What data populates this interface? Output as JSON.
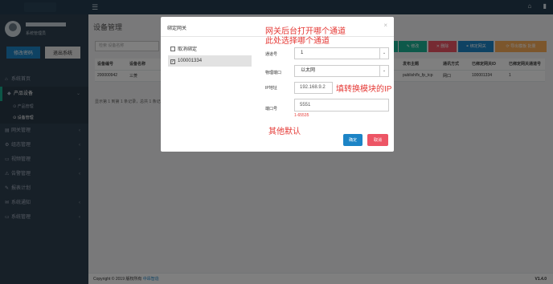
{
  "header": {
    "logo_text": "Mealsi"
  },
  "user": {
    "role": "系统管理员"
  },
  "sidebar": {
    "change_password": "修改密码",
    "logout": "退出系统",
    "items": [
      {
        "label": "系统首页"
      },
      {
        "label": "产品设备"
      },
      {
        "label": "网关管理"
      },
      {
        "label": "组态管理"
      },
      {
        "label": "视频管理"
      },
      {
        "label": "告警管理"
      },
      {
        "label": "报表计划"
      },
      {
        "label": "系统通知"
      },
      {
        "label": "系统管理"
      }
    ],
    "subitems": [
      {
        "label": "产品管理"
      },
      {
        "label": "设备管理"
      }
    ]
  },
  "main": {
    "title": "设备管理",
    "search_placeholder": "检索 设备名称",
    "toolbar": {
      "edit": "修改",
      "delete": "删除",
      "bind_gateway": "绑定网关",
      "batch": "导出模板 批量"
    },
    "columns": [
      "设备编号",
      "设备名称",
      "",
      "发布主题",
      "通讯方式",
      "已绑定网关ID",
      "已绑定网关通道号"
    ],
    "rows": [
      [
        "200000942",
        "三菱",
        "",
        "publish/fx_fp_tcp",
        "网口",
        "100001334",
        "1"
      ]
    ],
    "pager": "显示第 1 到第 1 条记录，总共 1 条记录"
  },
  "footer": {
    "copyright": "Copyright © 2019 版权所有",
    "company": "中昂智造",
    "version": "V1.4.0"
  },
  "modal": {
    "title": "绑定网关",
    "gateways": [
      {
        "label": "取消绑定",
        "checked": false
      },
      {
        "label": "100001334",
        "checked": true
      }
    ],
    "labels": {
      "channel": "通道号",
      "port_type": "物理端口",
      "ip": "IP地址",
      "port": "端口号"
    },
    "values": {
      "channel": "1",
      "port_type": "以太网",
      "ip": "192.168.9.2",
      "port": "5551"
    },
    "port_hint": "1-65535",
    "ok": "确定",
    "cancel": "取消"
  },
  "annotations": {
    "line1": "网关后台打开哪个通道",
    "line2": "此处选择哪个通道",
    "ip_note": "填转换模块的IP",
    "default_note": "其他默认"
  },
  "colors": {
    "primary": "#1c84c6",
    "danger": "#ed5565",
    "sidebar": "#2f4050",
    "topbar": "#243d50",
    "annotation": "#e53935"
  }
}
